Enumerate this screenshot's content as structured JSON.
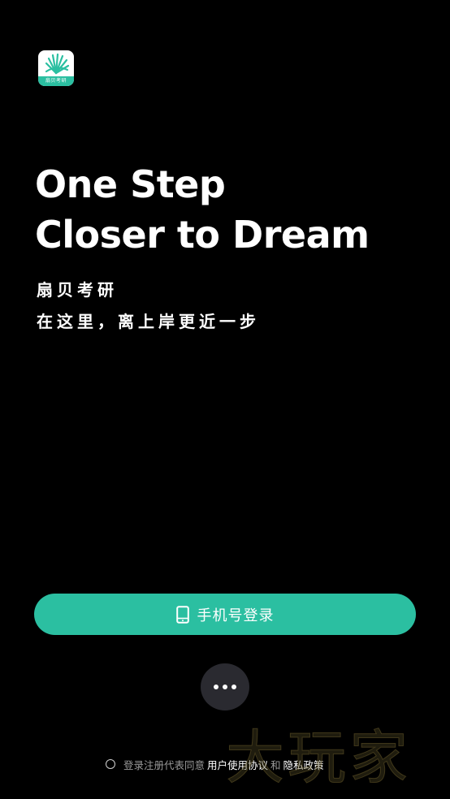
{
  "app": {
    "logo_text": "扇贝考研",
    "brand_color": "#2bbfa1",
    "logo_icon": "fan-rays-icon"
  },
  "headline": {
    "line1": "One Step",
    "line2": "Closer to Dream"
  },
  "subtitle": {
    "line1": "扇贝考研",
    "line2": "在这里，离上岸更近一步"
  },
  "login": {
    "phone_label": "手机号登录",
    "phone_icon": "mobile-phone-icon",
    "more_icon": "more-dots-icon"
  },
  "agreement": {
    "prefix": "登录注册代表同意",
    "user_agreement": "用户使用协议",
    "conjunction": "和",
    "privacy_policy": "隐私政策"
  },
  "watermark": {
    "text": "大玩家"
  },
  "colors": {
    "background": "#000000",
    "button": "#2bbfa1",
    "more_button": "#2a2a30",
    "muted_text": "#9a9a9a"
  }
}
